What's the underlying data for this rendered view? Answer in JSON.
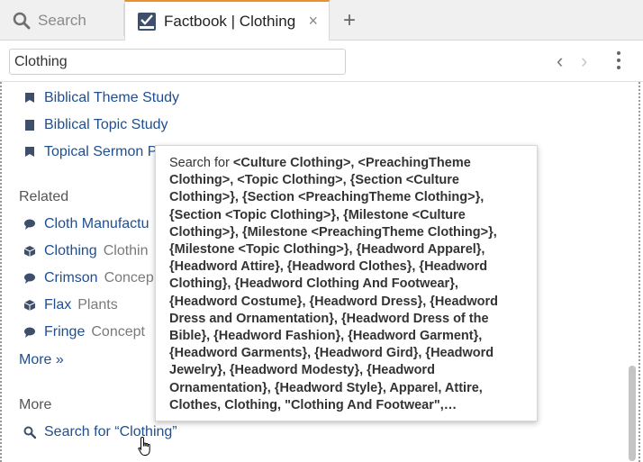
{
  "tabs": [
    {
      "label": "Search",
      "icon": "search-icon",
      "active": false
    },
    {
      "label": "Factbook | Clothing",
      "icon": "factbook-icon",
      "active": true
    }
  ],
  "tab_close": "×",
  "tab_add": "+",
  "toolbar": {
    "search_value": "Clothing",
    "back": "‹",
    "forward": "›"
  },
  "guides": [
    {
      "label": "Biblical Theme Study",
      "icon": "guide-icon"
    },
    {
      "label": "Biblical Topic Study",
      "icon": "guide-icon"
    },
    {
      "label": "Topical Sermon P",
      "icon": "guide-icon"
    }
  ],
  "related": {
    "heading": "Related",
    "items": [
      {
        "label": "Cloth Manufactu",
        "type": "",
        "icon": "concept-icon"
      },
      {
        "label": "Clothing",
        "type": "Clothin",
        "icon": "cube-icon"
      },
      {
        "label": "Crimson",
        "type": "Concep",
        "icon": "concept-icon"
      },
      {
        "label": "Flax",
        "type": "Plants",
        "icon": "cube-icon"
      },
      {
        "label": "Fringe",
        "type": "Concept",
        "icon": "concept-icon"
      }
    ],
    "more": "More »"
  },
  "more_section": {
    "heading": "More",
    "search_link": "Search for “Clothing”"
  },
  "tooltip": {
    "prefix": "Search for ",
    "text": "<Culture Clothing>, <PreachingTheme Clothing>, <Topic Clothing>, {Section <Culture Clothing>}, {Section <PreachingTheme Clothing>}, {Section <Topic Clothing>}, {Milestone <Culture Clothing>}, {Milestone <PreachingTheme Clothing>}, {Milestone <Topic Clothing>}, {Headword Apparel}, {Headword Attire}, {Headword Clothes}, {Headword Clothing}, {Headword Clothing And Footwear}, {Headword Costume}, {Headword Dress}, {Headword Dress and Ornamentation}, {Headword Dress of the Bible}, {Headword Fashion}, {Headword Garment}, {Headword Garments}, {Headword Gird}, {Headword Jewelry}, {Headword Modesty}, {Headword Ornamentation}, {Headword Style}, Apparel, Attire, Clothes, Clothing, \"Clothing And Footwear\",…"
  },
  "colors": {
    "link": "#1f4f8f",
    "active_tab_accent": "#e8912d"
  }
}
